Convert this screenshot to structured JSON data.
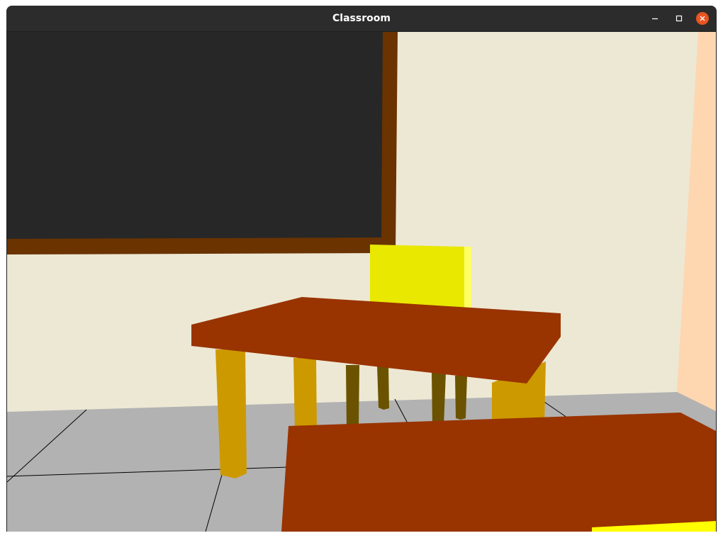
{
  "window": {
    "title": "Classroom",
    "controls": [
      "minimize-icon",
      "maximize-icon",
      "close-icon"
    ]
  },
  "colors": {
    "titlebar": "#2c2c2c",
    "close_button": "#e95420",
    "wall": "#ede8d4",
    "side_wall": "#fed6b0",
    "floor": "#b2b2b2",
    "floor_grout": "#000000",
    "chalkboard": "#272727",
    "chalkboard_frame": "#6a3300",
    "desk_top": "#993300",
    "desk_legs": "#cc9900",
    "chair_seat": "#e8e800",
    "chair_side": "#ffff66",
    "chair_legs": "#6b5200"
  }
}
